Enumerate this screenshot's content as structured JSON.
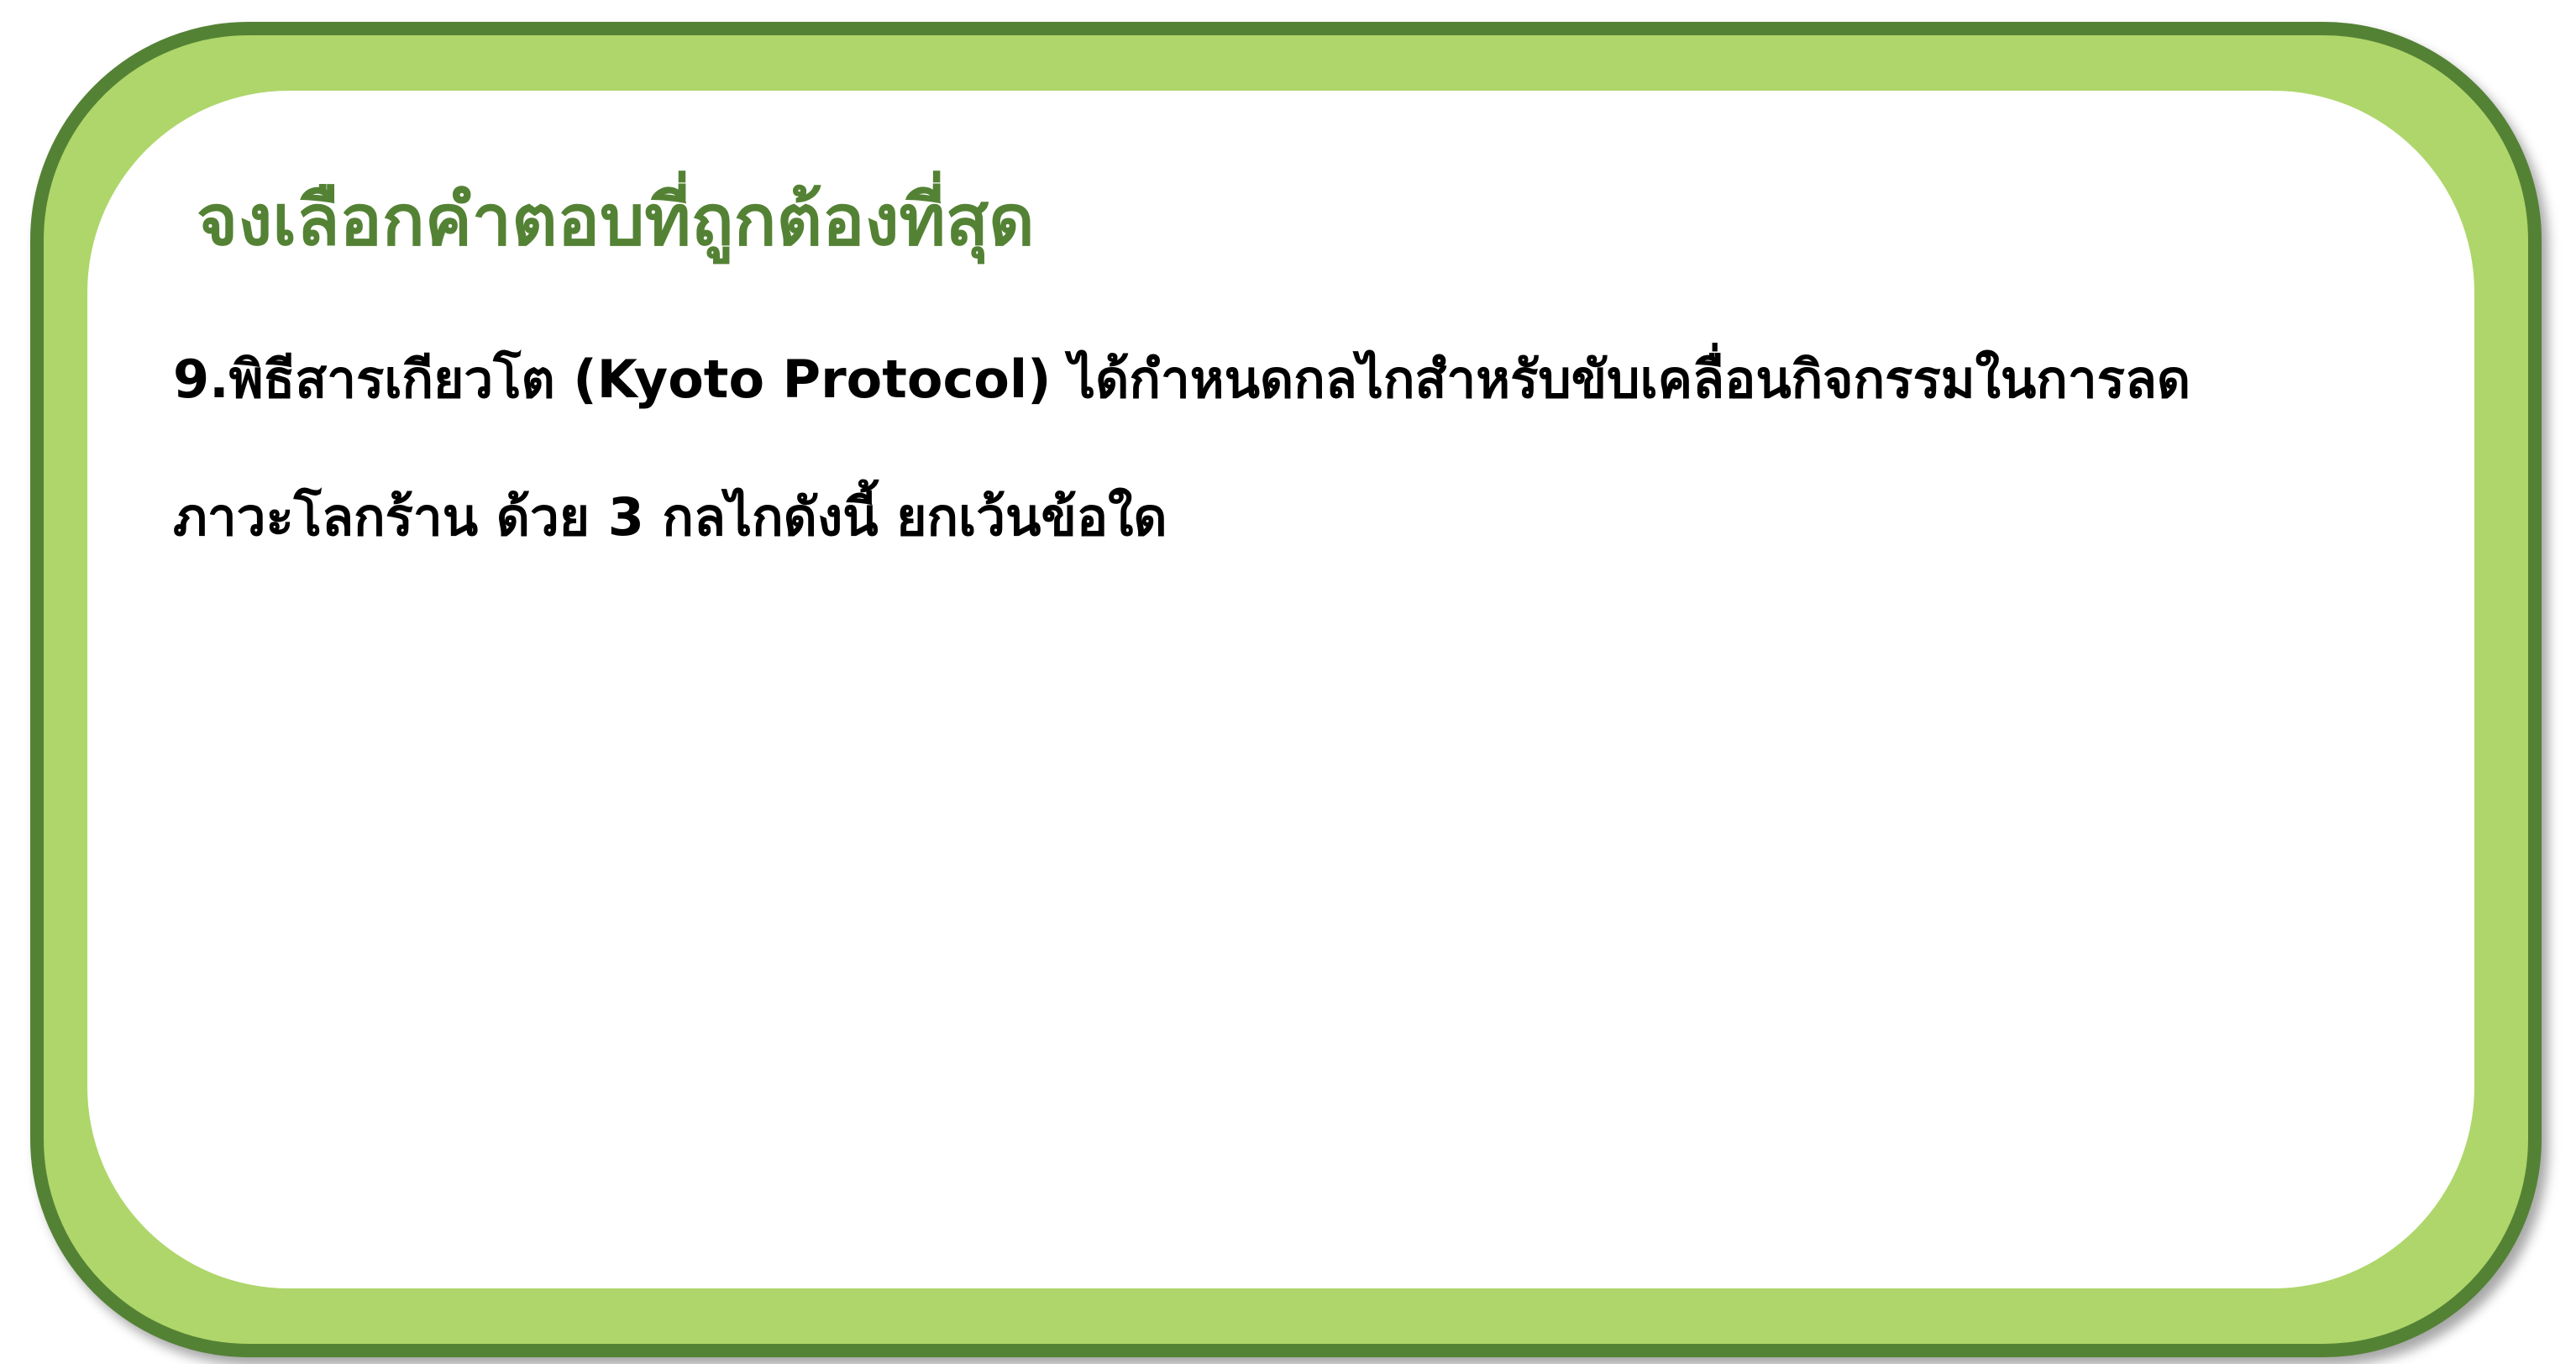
{
  "colors": {
    "frame_fill": "#aed66a",
    "frame_border": "#548235",
    "heading": "#548235",
    "question_text": "#000000",
    "background": "#ffffff"
  },
  "card": {
    "instruction": "จงเลือกคำตอบที่ถูกต้องที่สุด",
    "question": {
      "line1": "9.พิธีสารเกียวโต (Kyoto  Protocol) ได้กำหนดกลไกสำหรับขับเคลื่อนกิจกรรมในการลด",
      "line2": "ภาวะโลกร้าน ด้วย 3 กลไกดังนี้ ยกเว้นข้อใด"
    }
  }
}
